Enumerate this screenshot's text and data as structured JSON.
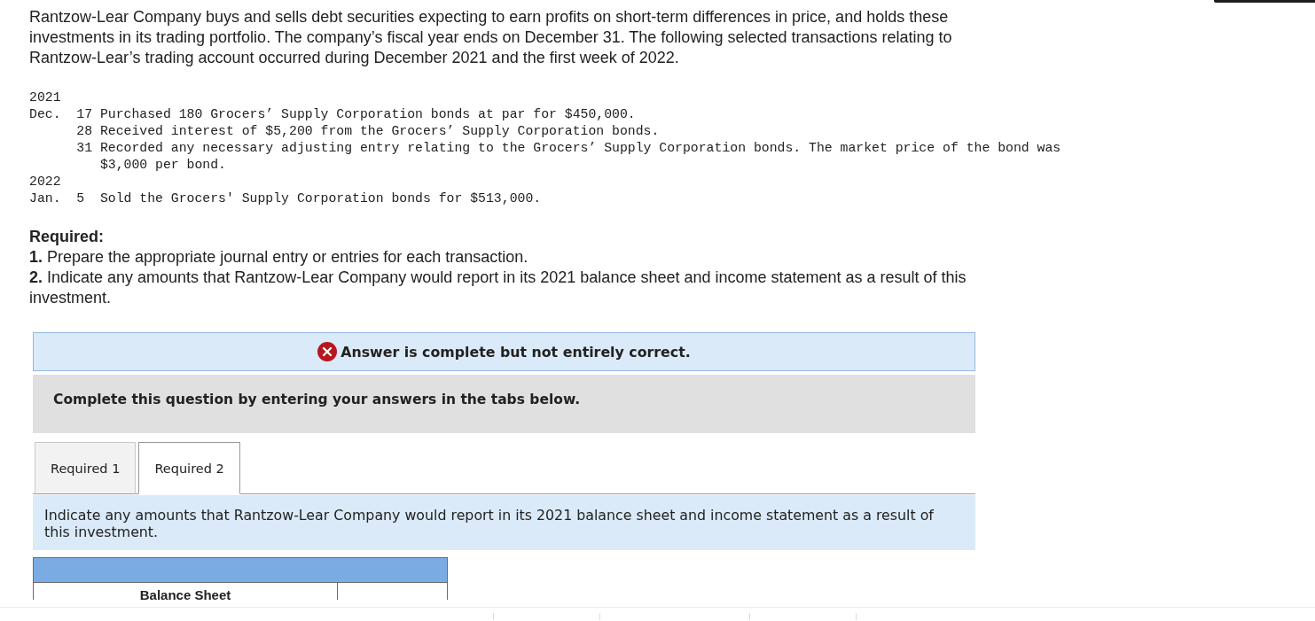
{
  "intro": "Rantzow-Lear Company buys and sells debt securities expecting to earn profits on short-term differences in price, and holds these investments in its trading portfolio. The company’s fiscal year ends on December 31. The following selected transactions relating to Rantzow-Lear’s trading account occurred during December 2021 and the first week of 2022.",
  "transactions": [
    {
      "year": "2021",
      "entries": [
        {
          "month": "Dec.",
          "day": "17",
          "text": "Purchased 180 Grocers’ Supply Corporation bonds at par for $450,000."
        },
        {
          "day": "28",
          "text": "Received interest of $5,200 from the Grocers’ Supply Corporation bonds."
        },
        {
          "day": "31",
          "text": "Recorded any necessary adjusting entry relating to the Grocers’ Supply Corporation bonds. The market price of the bond was $3,000 per bond."
        }
      ]
    },
    {
      "year": "2022",
      "entries": [
        {
          "month": "Jan.",
          "day": "5",
          "text": "Sold the Grocers' Supply Corporation bonds for $513,000."
        }
      ]
    }
  ],
  "required": {
    "heading": "Required:",
    "items": [
      "**1.** Prepare the appropriate journal entry or entries for each transaction.",
      "**2.** Indicate any amounts that Rantzow-Lear Company would report in its 2021 balance sheet and income statement as a result of this investment."
    ]
  },
  "feedback": {
    "correct": false,
    "text": "Answer is complete but not entirely correct."
  },
  "instruction": "Complete this question by entering your answers in the tabs below.",
  "tabs": [
    {
      "label": "Required 1",
      "selected": false
    },
    {
      "label": "Required 2",
      "selected": true
    }
  ],
  "tab_prompt": "Indicate any amounts that Rantzow-Lear Company would report in its 2021 balance sheet and income statement as a result of this investment.",
  "table": {
    "columns": [
      {
        "kind": "label",
        "heading": "Balance Sheet"
      },
      {
        "kind": "amount"
      }
    ]
  }
}
